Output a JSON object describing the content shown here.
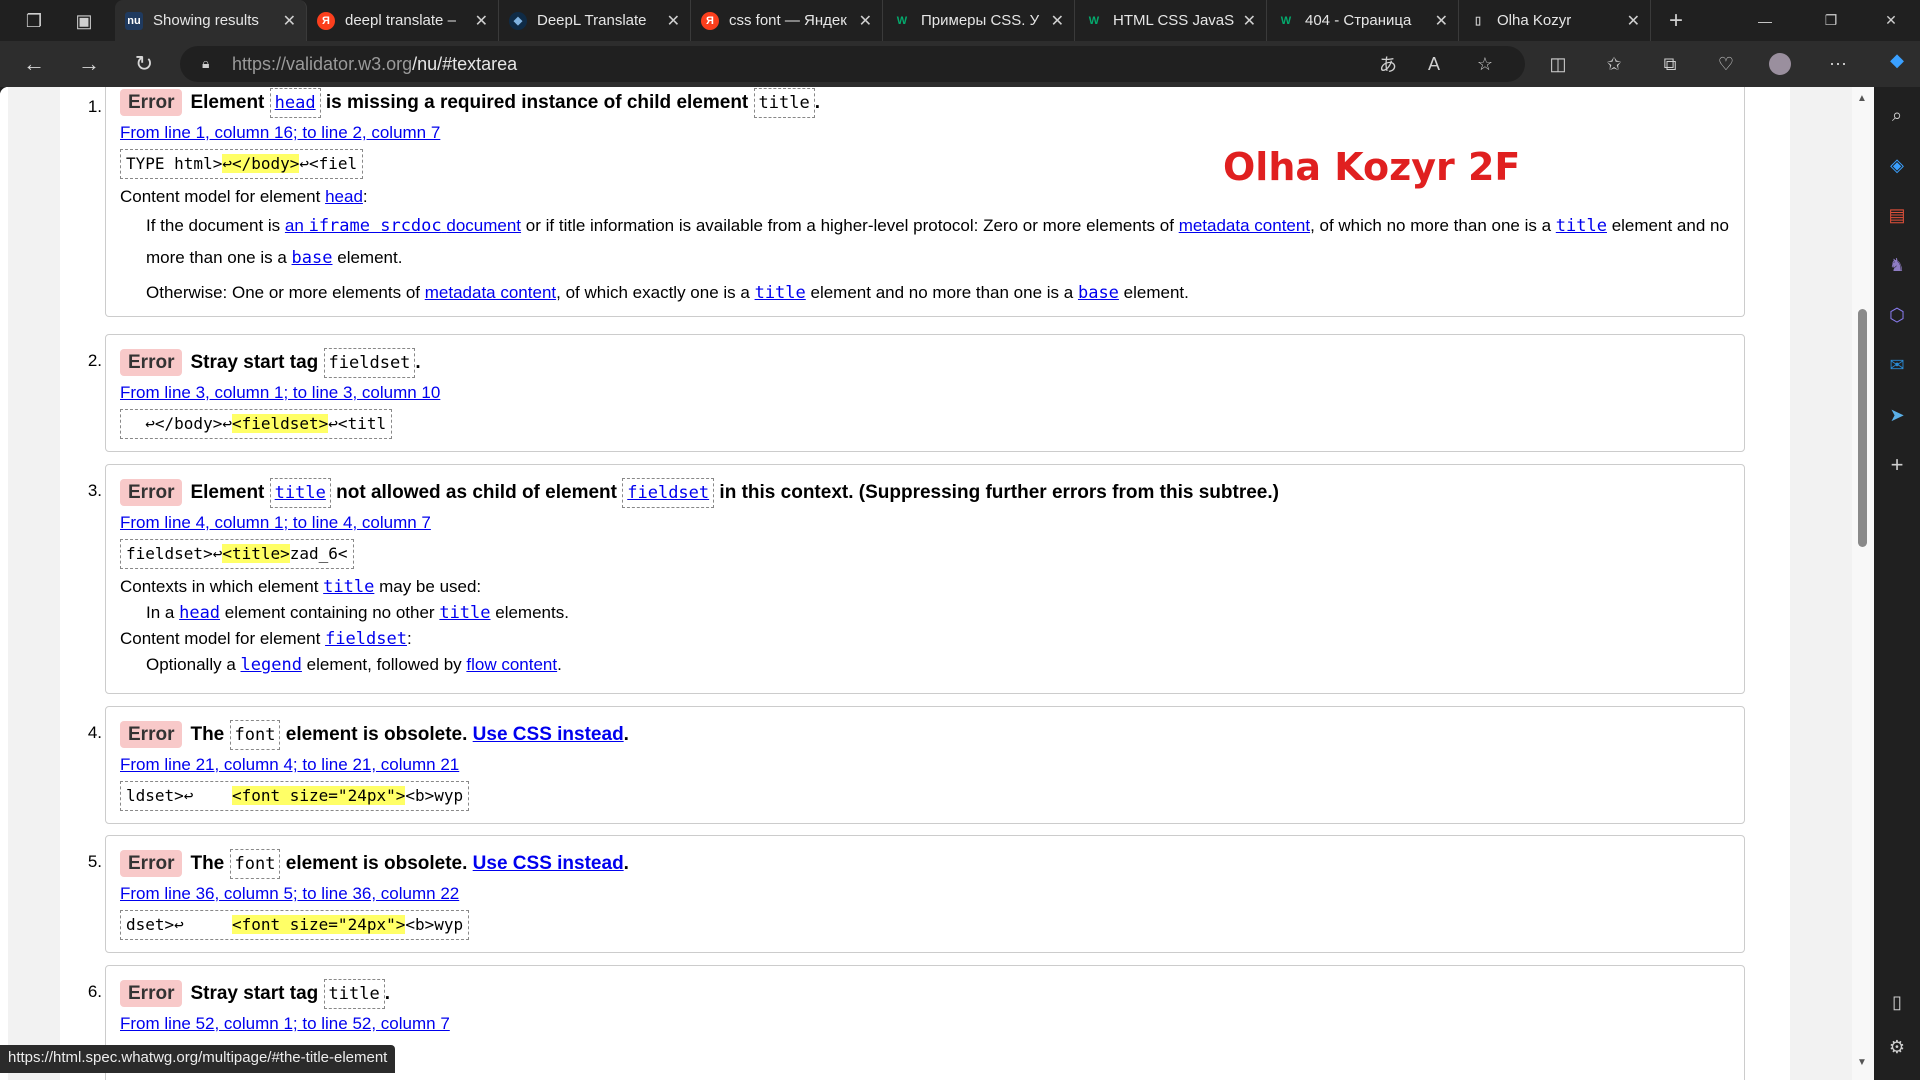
{
  "tabs": [
    {
      "title": "Showing results",
      "fav": "nu",
      "fav_bg": "#1f3a5f",
      "fav_fg": "#ffffff"
    },
    {
      "title": "deepl translate –",
      "fav": "Я",
      "fav_bg": "#fc3f1d",
      "fav_fg": "#ffffff"
    },
    {
      "title": "DeepL Translate",
      "fav": "◆",
      "fav_bg": "#0f2b46",
      "fav_fg": "#7fb2e0"
    },
    {
      "title": "css font — Яндек",
      "fav": "Я",
      "fav_bg": "#fc3f1d",
      "fav_fg": "#ffffff"
    },
    {
      "title": "Примеры CSS. У",
      "fav": "W",
      "fav_bg": "#202020",
      "fav_fg": "#04aa6d"
    },
    {
      "title": "HTML CSS JavaS",
      "fav": "W",
      "fav_bg": "#202020",
      "fav_fg": "#04aa6d"
    },
    {
      "title": "404 - Страница",
      "fav": "W",
      "fav_bg": "#202020",
      "fav_fg": "#04aa6d"
    },
    {
      "title": "Olha Kozyr",
      "fav": "▯",
      "fav_bg": "#202020",
      "fav_fg": "#cfcfcf"
    }
  ],
  "address": {
    "host": "https://validator.w3.org",
    "path": "/nu/#textarea"
  },
  "watermark": "Olha Kozyr 2F",
  "status_url": "https://html.spec.whatwg.org/multipage/#the-title-element",
  "messages": [
    {
      "num": "1.",
      "err": "Error",
      "h1": "Element",
      "c1": "head",
      "h2": "is missing a required instance of child element",
      "c2": "title",
      "h3": ".",
      "loc": "From line 1, column 16; to line 2, column 7",
      "ex_pre": "TYPE html>",
      "ex_hl": "↩</body>",
      "ex_post": "↩<fiel",
      "cm_label": "Content model for element",
      "cm_el": "head",
      "cm_colon": ":",
      "p1_a": "If the document is",
      "p1_link1": "an",
      "p1_code": "iframe srcdoc",
      "p1_link2": "document",
      "p1_b": "or if title information is available from a higher-level protocol: Zero or more elements of",
      "p1_link3": "metadata content",
      "p1_c": ", of which no more than one is a",
      "p1_code2": "title",
      "p1_d": "element and",
      "p1_e": "no more than one is a",
      "p1_code3": "base",
      "p1_f": "element.",
      "p2_a": "Otherwise: One or more elements of",
      "p2_link": "metadata content",
      "p2_b": ", of which exactly one is a",
      "p2_code": "title",
      "p2_c": "element and no more than one is a",
      "p2_code2": "base",
      "p2_d": "element."
    },
    {
      "num": "2.",
      "err": "Error",
      "h1": "Stray start tag",
      "c1": "fieldset",
      "h2": ".",
      "loc": "From line 3, column 1; to line 3, column 10",
      "ex_pre": "  ↩</body>↩",
      "ex_hl": "<fieldset>",
      "ex_post": "↩<titl"
    },
    {
      "num": "3.",
      "err": "Error",
      "h1": "Element",
      "c1": "title",
      "h2": "not allowed as child of element",
      "c2": "fieldset",
      "h3": "in this context. (Suppressing further errors from this subtree.)",
      "loc": "From line 4, column 1; to line 4, column 7",
      "ex_pre": "fieldset>↩",
      "ex_hl": "<title>",
      "ex_post": "zad_6<",
      "ctx_a": "Contexts in which element",
      "ctx_code": "title",
      "ctx_b": "may be used:",
      "ctx_i_a": "In a",
      "ctx_i_code": "head",
      "ctx_i_b": "element containing no other",
      "ctx_i_code2": "title",
      "ctx_i_c": "elements.",
      "cm_label": "Content model for element",
      "cm_el": "fieldset",
      "cm_colon": ":",
      "cm_i_a": "Optionally a",
      "cm_i_code": "legend",
      "cm_i_b": "element, followed by",
      "cm_i_link": "flow content",
      "cm_i_c": "."
    },
    {
      "num": "4.",
      "err": "Error",
      "h1": "The",
      "c1": "font",
      "h2": "element is obsolete.",
      "link": "Use CSS instead",
      "h3": ".",
      "loc": "From line 21, column 4; to line 21, column 21",
      "ex_pre": "ldset>↩    ",
      "ex_hl": "<font size=\"24px\">",
      "ex_post": "<b>wyp"
    },
    {
      "num": "5.",
      "err": "Error",
      "h1": "The",
      "c1": "font",
      "h2": "element is obsolete.",
      "link": "Use CSS instead",
      "h3": ".",
      "loc": "From line 36, column 5; to line 36, column 22",
      "ex_pre": "dset>↩     ",
      "ex_hl": "<font size=\"24px\">",
      "ex_post": "<b>wyp"
    },
    {
      "num": "6.",
      "err": "Error",
      "h1": "Stray start tag",
      "c1": "title",
      "h2": ".",
      "loc": "From line 52, column 1; to line 52, column 7"
    }
  ]
}
